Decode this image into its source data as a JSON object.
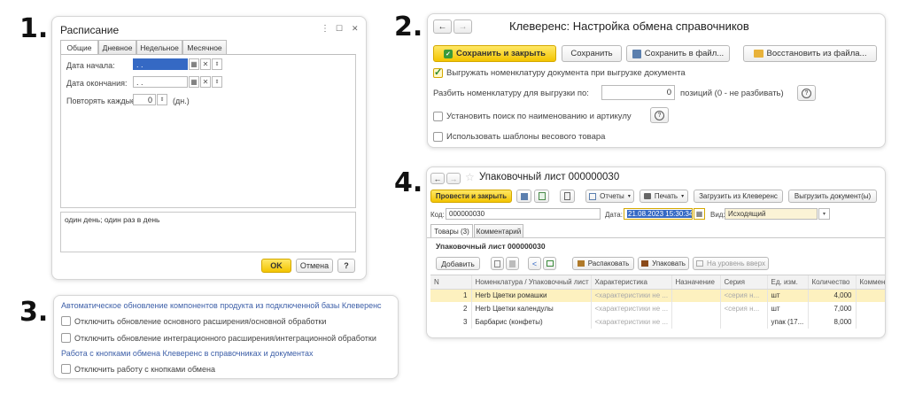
{
  "labels": {
    "n1": "1.",
    "n2": "2.",
    "n3": "3.",
    "n4": "4."
  },
  "p1": {
    "title": "Расписание",
    "tabs": [
      "Общие",
      "Дневное",
      "Недельное",
      "Месячное"
    ],
    "start_label": "Дата начала:",
    "start_value": "  .  .    ",
    "end_label": "Дата окончания:",
    "end_value": "  .  .    ",
    "repeat_label": "Повторять каждые:",
    "repeat_value": "0",
    "repeat_unit": "(дн.)",
    "summary": "один день; один раз в день",
    "ok": "OK",
    "cancel": "Отмена",
    "help": "?",
    "menu_dots": "⋮",
    "maximize": "☐",
    "close": "✕"
  },
  "p2": {
    "title": "Клеверенс: Настройка обмена справочников",
    "save_close": "Сохранить и закрыть",
    "save": "Сохранить",
    "save_file": "Сохранить в файл...",
    "restore_file": "Восстановить из файла...",
    "export_opt": "Выгружать номенклатуру документа при выгрузке документа",
    "split_label": "Разбить номенклатуру для выгрузки по:",
    "split_value": "0",
    "split_suffix": "позиций (0 - не разбивать)",
    "search_opt": "Установить поиск по наименованию и артикулу",
    "weight_opt": "Использовать шаблоны весового товара",
    "help": "?"
  },
  "p3": {
    "link1": "Автоматическое обновление компонентов продукта из подключенной базы Клеверенс",
    "opt1": "Отключить обновление основного расширения/основной обработки",
    "opt2": "Отключить обновление интеграционного расширения/интеграционной обработки",
    "link2": "Работа с кнопками обмена Клеверенс в справочниках и документах",
    "opt3": "Отключить работу с кнопками обмена"
  },
  "p4": {
    "title": "Упаковочный лист 000000030",
    "post_close": "Провести и закрыть",
    "reports": "Отчеты",
    "print": "Печать",
    "load": "Загрузить из Клеверенс",
    "unload": "Выгрузить документ(ы)",
    "code_label": "Код:",
    "code_value": "000000030",
    "date_label": "Дата:",
    "date_value": "21.08.2023 15:30:34",
    "kind_label": "Вид:",
    "kind_value": "Исходящий",
    "tab_goods": "Товары (3)",
    "tab_comment": "Комментарий",
    "section_title": "Упаковочный лист 000000030",
    "add": "Добавить",
    "unpack": "Распаковать",
    "pack": "Упаковать",
    "level_up": "На уровень вверх",
    "columns": [
      "N",
      "Номенклатура / Упаковочный лист",
      "Характеристика",
      "Назначение",
      "Серия",
      "Ед. изм.",
      "Количество",
      "Коммен"
    ],
    "rows": [
      {
        "n": "1",
        "name": "Herb Цветки ромашки",
        "char": "<характеристики не ...",
        "dest": "",
        "series": "<серия н...",
        "unit": "шт",
        "qty": "4,000"
      },
      {
        "n": "2",
        "name": "Herb Цветки календулы",
        "char": "<характеристики не ...",
        "dest": "",
        "series": "<серия н...",
        "unit": "шт",
        "qty": "7,000"
      },
      {
        "n": "3",
        "name": "Барбарис (конфеты)",
        "char": "<характеристики не ...",
        "dest": "",
        "series": "",
        "unit": "упак (17...",
        "qty": "8,000"
      }
    ]
  },
  "colors": {
    "accent_yellow": "#f3c400",
    "link_blue": "#3d5fa8",
    "row_selected": "#fdf1bf",
    "date_blue": "#3569c4"
  }
}
